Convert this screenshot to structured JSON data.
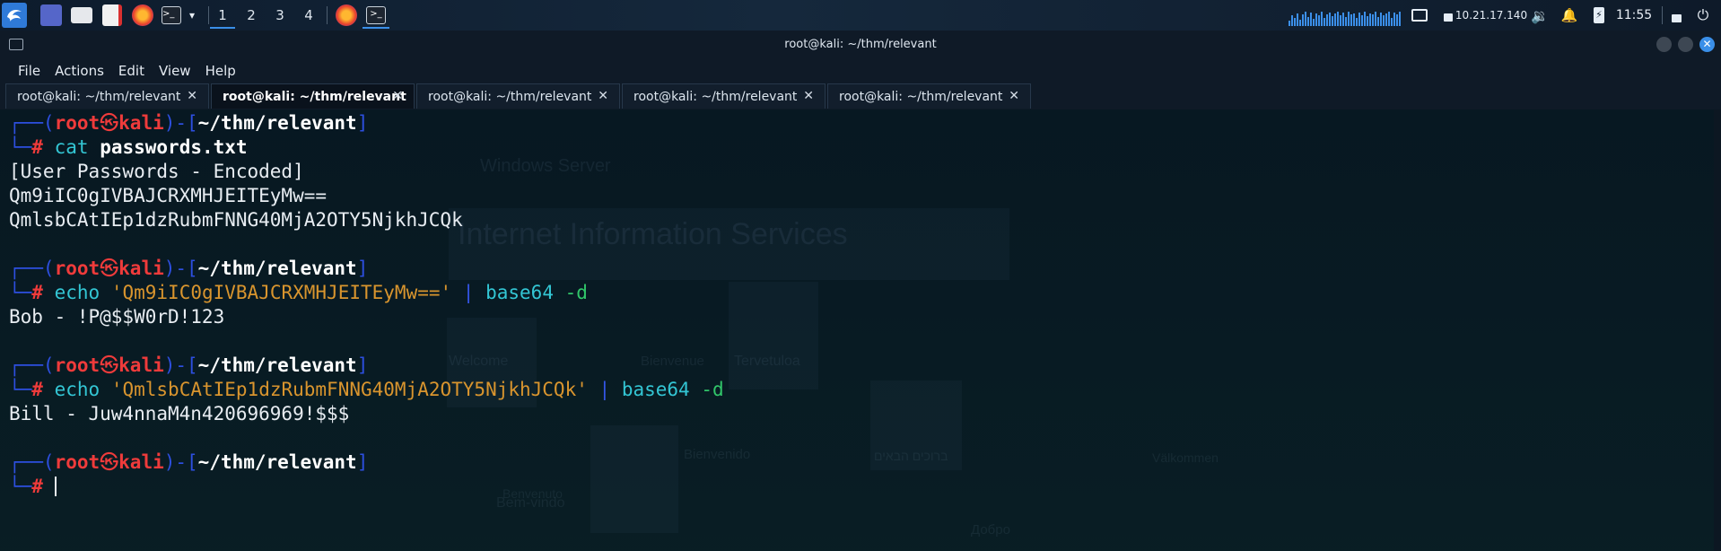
{
  "taskbar": {
    "workspaces": [
      "1",
      "2",
      "3",
      "4"
    ],
    "active_workspace": "1",
    "ip": "10.21.17.140",
    "time": "11:55"
  },
  "window": {
    "title": "root@kali: ~/thm/relevant",
    "menu": [
      "File",
      "Actions",
      "Edit",
      "View",
      "Help"
    ],
    "tabs": [
      {
        "label": "root@kali: ~/thm/relevant",
        "active": false
      },
      {
        "label": "root@kali: ~/thm/relevant",
        "active": true
      },
      {
        "label": "root@kali: ~/thm/relevant",
        "active": false
      },
      {
        "label": "root@kali: ~/thm/relevant",
        "active": false
      },
      {
        "label": "root@kali: ~/thm/relevant",
        "active": false
      }
    ]
  },
  "terminal": {
    "prompt": {
      "user": "root",
      "host": "kali",
      "path": "~/thm/relevant",
      "symbol": "#"
    },
    "cmd1": {
      "cmd": "cat",
      "arg": "passwords.txt"
    },
    "out1": [
      "[User Passwords - Encoded]",
      "Qm9iIC0gIVBAJCRXMHJEITEyMw==",
      "QmlsbCAtIEp1dzRubmFNNG40MjA2OTY5NjkhJCQk"
    ],
    "cmd2": {
      "cmd": "echo",
      "str": "'Qm9iIC0gIVBAJCRXMHJEITEyMw=='",
      "pipe": "|",
      "prog": "base64",
      "flag": "-d"
    },
    "out2": "Bob - !P@$$W0rD!123",
    "cmd3": {
      "cmd": "echo",
      "str": "'QmlsbCAtIEp1dzRubmFNNG40MjA2OTY5NjkhJCQk'",
      "pipe": "|",
      "prog": "base64",
      "flag": "-d"
    },
    "out3": "Bill - Juw4nnaM4n420696969!$$$"
  },
  "background_window": {
    "brand": "Windows Server",
    "heading": "Internet Information Services",
    "tiles": [
      "Welcome",
      "Bienvenue",
      "Tervetuloa",
      "Bienvenido",
      "Benvenuto",
      "ברוכים הבאים",
      "Bem-vindo",
      "Добро",
      "Välkommen"
    ]
  },
  "colors": {
    "accent": "#3a8fe8",
    "prompt_red": "#ef3b3b",
    "bracket_blue": "#2d4fe0",
    "cmd_cyan": "#33c6d4",
    "string_orange": "#d9952e",
    "flag_green": "#31c76a"
  }
}
